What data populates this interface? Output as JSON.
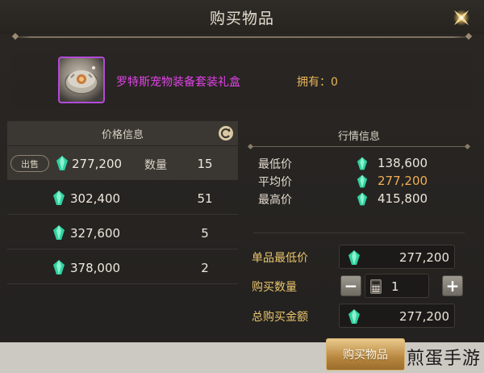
{
  "window": {
    "title": "购买物品"
  },
  "item": {
    "name": "罗特斯宠物装备套装礼盒",
    "owned_text": "拥有：0"
  },
  "price_info": {
    "header": "价格信息",
    "sell_tag": "出售",
    "qty_label": "数量",
    "rows": [
      {
        "price": "277,200",
        "qty": "15"
      },
      {
        "price": "302,400",
        "qty": "51"
      },
      {
        "price": "327,600",
        "qty": "5"
      },
      {
        "price": "378,000",
        "qty": "2"
      }
    ]
  },
  "market_info": {
    "header": "行情信息",
    "stats": [
      {
        "label": "最低价",
        "value": "138,600"
      },
      {
        "label": "平均价",
        "value": "277,200"
      },
      {
        "label": "最高价",
        "value": "415,800"
      }
    ]
  },
  "purchase_form": {
    "unit_price_label": "单品最低价",
    "unit_price": "277,200",
    "quantity_label": "购买数量",
    "quantity": "1",
    "total_label": "总购买金额",
    "total": "277,200",
    "minus_symbol": "−",
    "plus_symbol": "+"
  },
  "buy_button_label": "购买物品",
  "watermark": "煎蛋手游",
  "colors": {
    "item_name": "#e044e6",
    "owned": "#e9b65a",
    "average_price": "#f1ad52",
    "form_label": "#e9c56d",
    "gem": "#2fd3a0",
    "item_border": "#b24bd8"
  },
  "icons": {
    "close": "close-star-icon",
    "refresh": "refresh-icon",
    "currency": "gem-icon",
    "calculator": "calculator-icon"
  }
}
